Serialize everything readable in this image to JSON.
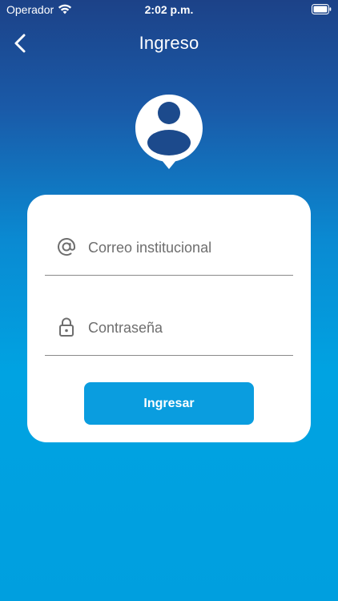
{
  "status_bar": {
    "carrier": "Operador",
    "time": "2:02 p.m."
  },
  "nav": {
    "title": "Ingreso",
    "back_icon": "chevron-left-icon"
  },
  "login_form": {
    "email_placeholder": "Correo institucional",
    "email_icon": "at-sign-icon",
    "password_placeholder": "Contraseña",
    "password_icon": "lock-icon",
    "submit_label": "Ingresar"
  },
  "colors": {
    "gradient_top": "#1c4288",
    "gradient_bottom": "#009fdf",
    "button": "#0a9ddf",
    "card": "#ffffff"
  }
}
